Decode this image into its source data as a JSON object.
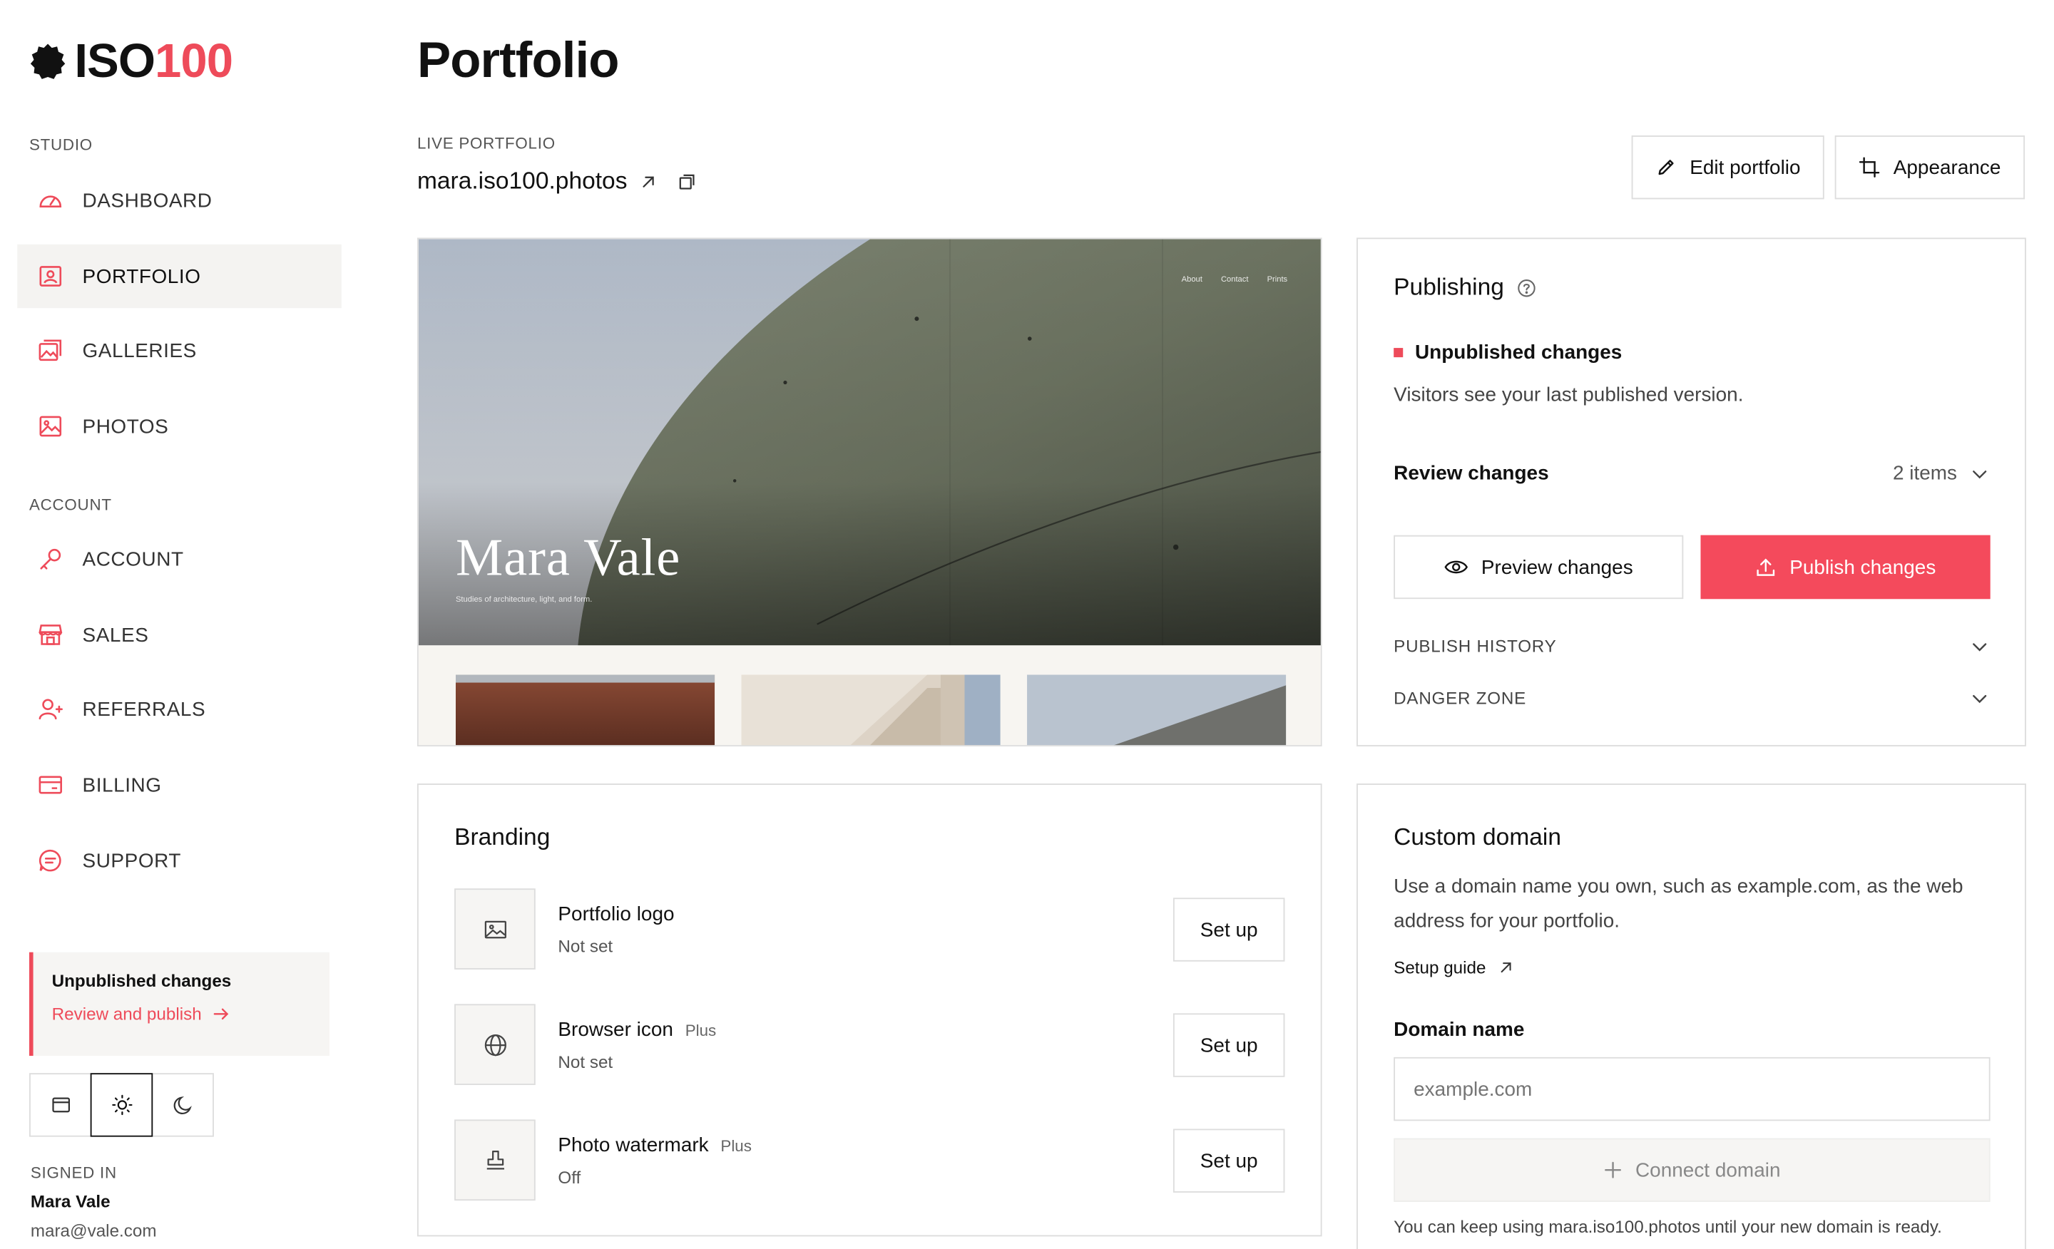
{
  "brand": {
    "logo_main": "ISO",
    "logo_accent": "100"
  },
  "sidebar": {
    "studio_label": "STUDIO",
    "account_label": "ACCOUNT",
    "studio_items": [
      {
        "label": "DASHBOARD",
        "icon": "gauge-icon"
      },
      {
        "label": "PORTFOLIO",
        "icon": "portfolio-icon",
        "active": true
      },
      {
        "label": "GALLERIES",
        "icon": "galleries-icon"
      },
      {
        "label": "PHOTOS",
        "icon": "photo-icon"
      }
    ],
    "account_items": [
      {
        "label": "ACCOUNT",
        "icon": "key-icon"
      },
      {
        "label": "SALES",
        "icon": "store-icon"
      },
      {
        "label": "REFERRALS",
        "icon": "user-plus-icon"
      },
      {
        "label": "BILLING",
        "icon": "card-icon"
      },
      {
        "label": "SUPPORT",
        "icon": "chat-icon"
      }
    ],
    "notice": {
      "title": "Unpublished changes",
      "link": "Review and publish"
    },
    "theme": {
      "options": [
        "system",
        "light",
        "dark"
      ],
      "selected": "light"
    },
    "signed_in": {
      "label": "SIGNED IN",
      "name": "Mara Vale",
      "email": "mara@vale.com"
    }
  },
  "main": {
    "title": "Portfolio",
    "live_label": "LIVE PORTFOLIO",
    "live_url": "mara.iso100.photos",
    "edit_button": "Edit portfolio",
    "appearance_button": "Appearance"
  },
  "preview": {
    "nav": [
      "About",
      "Contact",
      "Prints"
    ],
    "site_title": "Mara Vale",
    "site_subtitle": "Studies of architecture, light, and form."
  },
  "publishing": {
    "title": "Publishing",
    "status": "Unpublished changes",
    "description": "Visitors see your last published version.",
    "review_label": "Review changes",
    "review_count": "2 items",
    "preview_button": "Preview changes",
    "publish_button": "Publish changes",
    "history_label": "PUBLISH HISTORY",
    "danger_label": "DANGER ZONE"
  },
  "branding": {
    "title": "Branding",
    "rows": [
      {
        "name": "Portfolio logo",
        "badge": "",
        "status": "Not set",
        "button": "Set up",
        "icon": "image-icon"
      },
      {
        "name": "Browser icon",
        "badge": "Plus",
        "status": "Not set",
        "button": "Set up",
        "icon": "globe-icon"
      },
      {
        "name": "Photo watermark",
        "badge": "Plus",
        "status": "Off",
        "button": "Set up",
        "icon": "stamp-icon"
      }
    ]
  },
  "domain": {
    "title": "Custom domain",
    "description": "Use a domain name you own, such as example.com, as the web address for your portfolio.",
    "guide_link": "Setup guide",
    "field_label": "Domain name",
    "placeholder": "example.com",
    "connect_button": "Connect domain",
    "note": "You can keep using mara.iso100.photos until your new domain is ready."
  },
  "colors": {
    "accent": "#ee4b5a",
    "border": "#dddddd",
    "muted_bg": "#f6f5f3"
  }
}
